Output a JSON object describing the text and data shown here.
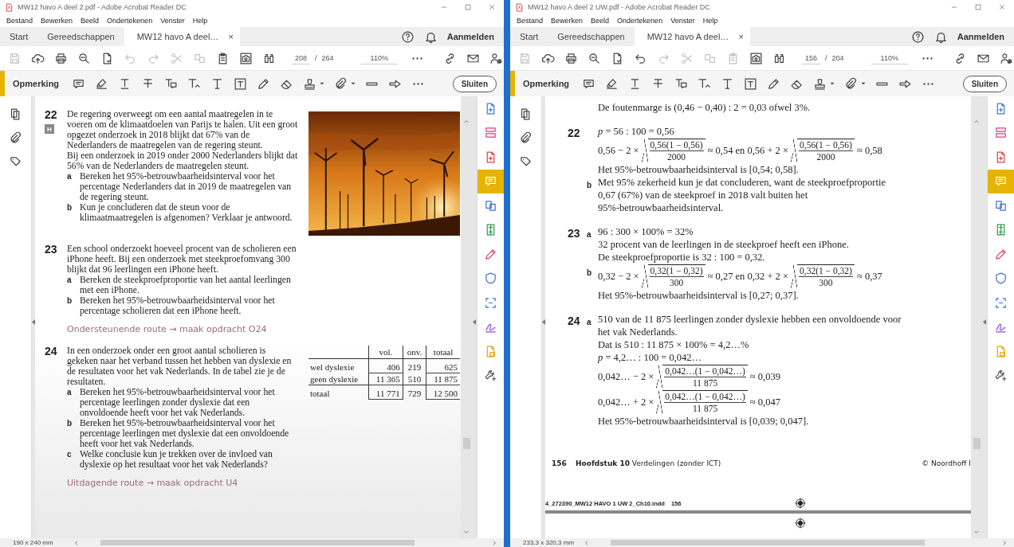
{
  "windows": [
    {
      "title": "MW12 havo A deel 2.pdf - Adobe Acrobat Reader DC",
      "menu": [
        "Bestand",
        "Bewerken",
        "Beeld",
        "Ondertekenen",
        "Venster",
        "Help"
      ],
      "tabs": [
        {
          "label": "Start",
          "selected": false
        },
        {
          "label": "Gereedschappen",
          "selected": false
        },
        {
          "label": "MW12 havo A deel…",
          "selected": true,
          "close": "×"
        }
      ],
      "account": "Aanmelden",
      "toolbar": [
        {
          "disabled": true
        },
        {
          "disabled": false
        },
        {
          "disabled": false
        },
        {
          "disabled": false
        },
        {
          "disabled": false
        },
        {
          "disabled": true
        },
        {
          "disabled": true
        },
        {
          "disabled": true
        },
        {
          "disabled": true
        },
        {
          "disabled": false
        },
        {
          "disabled": false
        },
        {
          "disabled": false
        }
      ],
      "page_number": "208",
      "page_separator": "/",
      "page_total": "264",
      "zoom": "110%",
      "comment_bar": {
        "label": "Opmerking",
        "close_button": "Sluiten"
      },
      "tools": [
        {
          "selected": false
        },
        {
          "selected": false
        },
        {
          "selected": false
        },
        {
          "selected": true
        },
        {
          "selected": false
        },
        {
          "selected": false
        },
        {
          "selected": false
        },
        {
          "selected": false
        },
        {
          "selected": false
        },
        {
          "selected": false
        },
        {
          "selected": false
        },
        {
          "selected": false
        }
      ],
      "status": "190 x 240 mm",
      "document": {
        "blocks": [
          {
            "kind": "exercise",
            "number": "22",
            "badge": "H",
            "paragraphs": [
              "De regering overweegt om een aantal maatregelen in te voeren om de klimaatdoelen van Parijs te halen. Uit een groot opgezet onderzoek in 2018 blijkt dat 67% van de Nederlanders de maatregelen van de regering steunt.",
              "Bij een onderzoek in 2019 onder 2000 Nederlanders blijkt dat 56% van de Nederlanders de maatregelen steunt."
            ],
            "items": [
              {
                "label": "a",
                "text": "Bereken het 95%-betrouwbaarheidsinterval voor het percentage Nederlanders dat in 2019 de maatregelen van de regering steunt."
              },
              {
                "label": "b",
                "text": "Kun je concluderen dat de steun voor de klimaatmaatregelen is afgenomen? Verklaar je antwoord."
              }
            ],
            "aside": {
              "kind": "picture"
            }
          },
          {
            "kind": "exercise",
            "number": "23",
            "paragraphs": [
              "Een school onderzoekt hoeveel procent van de scholieren een iPhone heeft. Bij een onderzoek met steekproefomvang 300 blijkt dat 96 leerlingen een iPhone heeft."
            ],
            "items": [
              {
                "label": "a",
                "text": "Bereken de steekproefproportie van het aantal leerlingen met een iPhone."
              },
              {
                "label": "b",
                "text": "Bereken het 95%-betrouwbaarheidsinterval voor het percentage scholieren dat een iPhone heeft."
              }
            ]
          },
          {
            "kind": "route",
            "text": "Ondersteunende route → maak opdracht O24"
          },
          {
            "kind": "exercise",
            "number": "24",
            "paragraphs": [
              "In een onderzoek onder een groot aantal scholieren is gekeken naar het verband tussen het hebben van dyslexie en de resultaten voor het vak Nederlands. In de tabel zie je de resultaten."
            ],
            "items": [
              {
                "label": "a",
                "text": "Bereken het 95%-betrouwbaarheidsinterval voor het percentage leerlingen zonder dyslexie dat een onvoldoende heeft voor het vak Nederlands."
              },
              {
                "label": "b",
                "text": "Bereken het 95%-betrouwbaarheidsinterval voor het percentage leerlingen met dyslexie dat een onvoldoende heeft voor het vak Nederlands."
              },
              {
                "label": "c",
                "text": "Welke conclusie kun je trekken over de invloed van dyslexie op het resultaat voor het vak Nederlands?"
              }
            ],
            "aside": {
              "kind": "table",
              "columns": [
                "vol.",
                "onv.",
                "totaal"
              ],
              "rows": [
                {
                  "label": "wel dyslexie",
                  "cells": [
                    "406",
                    "219",
                    "625"
                  ]
                },
                {
                  "label": "geen dyslexie",
                  "cells": [
                    "11 365",
                    "510",
                    "11 875"
                  ]
                }
              ],
              "total_row": {
                "label": "totaal",
                "cells": [
                  "11 771",
                  "729",
                  "12 500"
                ]
              }
            }
          },
          {
            "kind": "route",
            "text": "Uitdagende route → maak opdracht U4"
          }
        ]
      }
    },
    {
      "title": "MW12 havo A deel 2 UW.pdf - Adobe Acrobat Reader DC",
      "menu": [
        "Bestand",
        "Bewerken",
        "Beeld",
        "Ondertekenen",
        "Venster",
        "Help"
      ],
      "tabs": [
        {
          "label": "Start",
          "selected": false
        },
        {
          "label": "Gereedschappen",
          "selected": false
        },
        {
          "label": "MW12 havo A deel…",
          "selected": true,
          "close": "×"
        }
      ],
      "account": "Aanmelden",
      "toolbar": [
        {
          "disabled": true
        },
        {
          "disabled": false
        },
        {
          "disabled": false
        },
        {
          "disabled": false
        },
        {
          "disabled": false
        },
        {
          "disabled": false
        },
        {
          "disabled": true
        },
        {
          "disabled": true
        },
        {
          "disabled": true
        },
        {
          "disabled": true
        },
        {
          "disabled": false
        },
        {
          "disabled": false
        }
      ],
      "page_number": "156",
      "page_separator": "/",
      "page_total": "204",
      "zoom": "110%",
      "comment_bar": {
        "label": "Opmerking",
        "close_button": "Sluiten"
      },
      "tools": [
        {
          "selected": false
        },
        {
          "selected": false
        },
        {
          "selected": false
        },
        {
          "selected": true
        },
        {
          "selected": false
        },
        {
          "selected": false
        },
        {
          "selected": false
        },
        {
          "selected": false
        },
        {
          "selected": false
        },
        {
          "selected": false
        },
        {
          "selected": false
        },
        {
          "selected": false
        }
      ],
      "status": "233,3 x 320,3 mm",
      "document": {
        "blocks": [
          {
            "kind": "answer",
            "parts": [
              {
                "lines": [
                  {
                    "kind": "text",
                    "text": "De foutenmarge is (0,46 − 0,40) : 2 = 0,03 ofwel 3%."
                  }
                ]
              }
            ]
          },
          {
            "kind": "answer",
            "number": "22",
            "parts": [
              {
                "lines": [
                  {
                    "kind": "text",
                    "text": "*p* = 56 : 100 = 0,56"
                  },
                  {
                    "kind": "formula",
                    "segments": [
                      {
                        "kind": "text",
                        "text": "0,56 − 2 ×"
                      },
                      {
                        "kind": "root",
                        "num": "0,56(1 − 0,56)",
                        "den": "2000"
                      },
                      {
                        "kind": "text",
                        "text": "≈ 0,54 en 0,56 + 2 ×"
                      },
                      {
                        "kind": "root",
                        "num": "0,56(1 − 0,56)",
                        "den": "2000"
                      },
                      {
                        "kind": "text",
                        "text": "≈ 0,58"
                      }
                    ]
                  },
                  {
                    "kind": "text",
                    "text": "Het 95%-betrouwbaarheidsinterval is [0,54; 0,58]."
                  }
                ]
              },
              {
                "label": "b",
                "lines": [
                  {
                    "kind": "text",
                    "text": "Met 95% zekerheid kun je dat concluderen, want de steekproefproportie"
                  },
                  {
                    "kind": "text",
                    "text": "0,67 (67%) van de steekproef in 2018 valt buiten het"
                  },
                  {
                    "kind": "text",
                    "text": "95%-betrouwbaarheidsinterval."
                  }
                ]
              }
            ]
          },
          {
            "kind": "answer",
            "number": "23",
            "parts": [
              {
                "label": "a",
                "lines": [
                  {
                    "kind": "text",
                    "text": "96 : 300 × 100% = 32%"
                  },
                  {
                    "kind": "text",
                    "text": "32 procent van de leerlingen in de steekproef heeft een iPhone."
                  },
                  {
                    "kind": "text",
                    "text": "De steekproefproportie is 32 : 100 = 0,32."
                  }
                ]
              },
              {
                "label": "b",
                "lines": [
                  {
                    "kind": "formula",
                    "segments": [
                      {
                        "kind": "text",
                        "text": "0,32 − 2 ×"
                      },
                      {
                        "kind": "root",
                        "num": "0,32(1 − 0,32)",
                        "den": "300"
                      },
                      {
                        "kind": "text",
                        "text": "≈ 0,27 en 0,32 + 2 ×"
                      },
                      {
                        "kind": "root",
                        "num": "0,32(1 − 0,32)",
                        "den": "300"
                      },
                      {
                        "kind": "text",
                        "text": "≈ 0,37"
                      }
                    ]
                  },
                  {
                    "kind": "text",
                    "text": "Het 95%-betrouwbaarheidsinterval is [0,27; 0,37]."
                  }
                ]
              }
            ]
          },
          {
            "kind": "answer",
            "number": "24",
            "parts": [
              {
                "label": "a",
                "lines": [
                  {
                    "kind": "text",
                    "text": "510 van de 11 875 leerlingen zonder dyslexie hebben een onvoldoende voor"
                  },
                  {
                    "kind": "text",
                    "text": "het vak Nederlands."
                  },
                  {
                    "kind": "text",
                    "text": "Dat is 510 : 11 875 × 100% = 4,2…%"
                  },
                  {
                    "kind": "text",
                    "text": "*p* = 4,2… : 100 = 0,042…"
                  },
                  {
                    "kind": "formula",
                    "segments": [
                      {
                        "kind": "text",
                        "text": "0,042… − 2 ×"
                      },
                      {
                        "kind": "root",
                        "num": "0,042…(1 − 0,042…)",
                        "den": "11 875"
                      },
                      {
                        "kind": "text",
                        "text": "≈ 0,039"
                      }
                    ]
                  },
                  {
                    "kind": "formula",
                    "segments": [
                      {
                        "kind": "text",
                        "text": "0,042… + 2 ×"
                      },
                      {
                        "kind": "root",
                        "num": "0,042…(1 − 0,042…)",
                        "den": "11 875"
                      },
                      {
                        "kind": "text",
                        "text": "≈ 0,047"
                      }
                    ]
                  },
                  {
                    "kind": "text",
                    "text": "Het 95%-betrouwbaarheidsinterval is [0,039; 0,047]."
                  }
                ]
              }
            ]
          },
          {
            "kind": "footer",
            "page": "156",
            "text": "**Hoofdstuk 10** Verdelingen (zonder ICT)",
            "copyright": "© Noordhoff I"
          },
          {
            "kind": "slug",
            "text": "4_272390_MW12 HAVO 1 UW 2_Ch10.indd",
            "page": "156"
          }
        ]
      }
    }
  ]
}
